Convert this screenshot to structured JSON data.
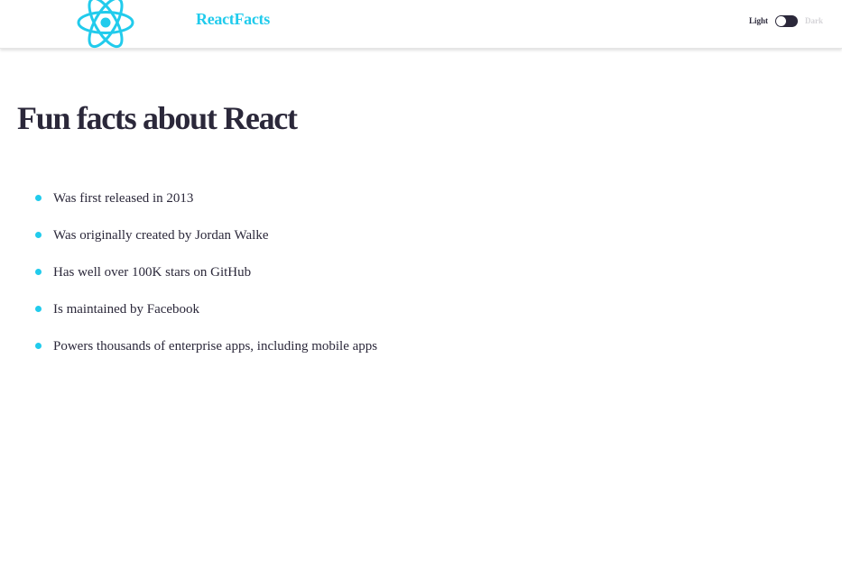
{
  "navbar": {
    "brand": "ReactFacts",
    "logo_icon": "react-atom-icon",
    "theme_toggle": {
      "light_label": "Light",
      "dark_label": "Dark",
      "state": "light"
    }
  },
  "main": {
    "title": "Fun facts about React",
    "facts": [
      "Was first released in 2013",
      "Was originally created by Jordan Walke",
      "Has well over 100K stars on GitHub",
      "Is maintained by Facebook",
      "Powers thousands of enterprise apps, including mobile apps"
    ]
  },
  "colors": {
    "accent": "#21cbec",
    "text": "#2b283a",
    "muted": "#d5d4d8",
    "background": "#ffffff"
  }
}
